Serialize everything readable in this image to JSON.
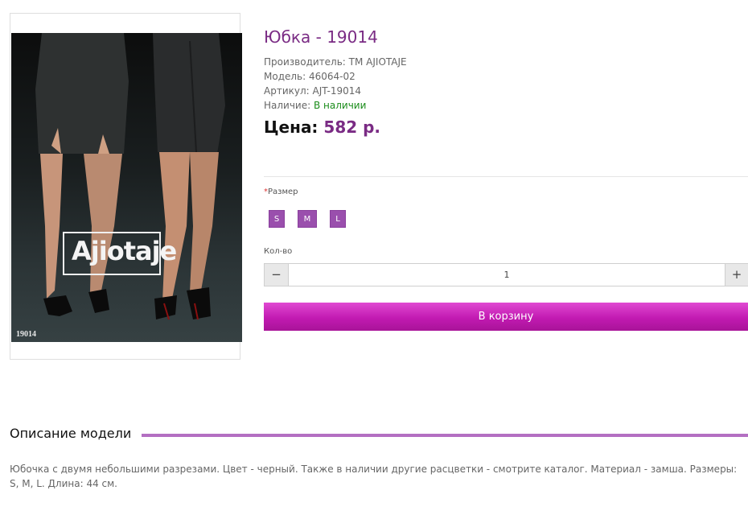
{
  "product": {
    "title": "Юбка - 19014",
    "manufacturer_label": "Производитель:",
    "manufacturer_value": "TM AJIOTAJE",
    "model_label": "Модель:",
    "model_value": "46064-02",
    "sku_label": "Артикул:",
    "sku_value": "AJT-19014",
    "availability_label": "Наличие:",
    "availability_value": "В наличии",
    "price_label": "Цена:",
    "price_value": "582 р."
  },
  "image": {
    "logo_text": "Ajiotaje",
    "code": "19014"
  },
  "options": {
    "size_label": "Размер",
    "required_mark": "*",
    "sizes": [
      "S",
      "M",
      "L"
    ]
  },
  "quantity": {
    "label": "Кол-во",
    "value": "1",
    "minus": "−",
    "plus": "+"
  },
  "cart": {
    "button_label": "В корзину"
  },
  "description": {
    "title": "Описание модели",
    "text": "Юбочка с двумя небольшими разрезами. Цвет - черный. Также в наличии другие расцветки - смотрите каталог. Материал - замша. Размеры: S, M, L. Длина: 44 см."
  },
  "colors": {
    "accent": "#7a2b84",
    "size_button": "#9a4fad",
    "cart_button": "#c21ab2",
    "in_stock": "#1a8c1a"
  }
}
